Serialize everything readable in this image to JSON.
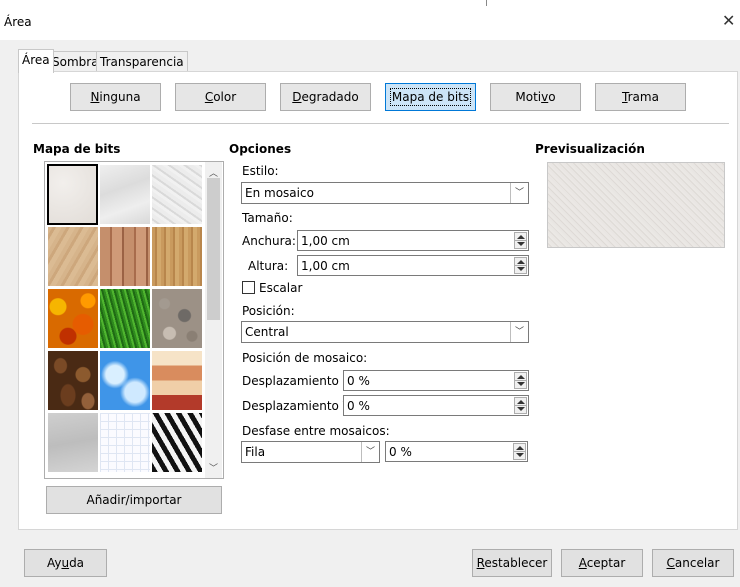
{
  "window": {
    "title": "Área",
    "close_glyph": "✕"
  },
  "tabs": [
    {
      "label": "Área",
      "active": true
    },
    {
      "label": "Sombra",
      "active": false
    },
    {
      "label": "Transparencia",
      "active": false
    }
  ],
  "fill_buttons": [
    {
      "label": "Ninguna",
      "mnemonic": "N",
      "selected": false
    },
    {
      "label": "Color",
      "mnemonic": "C",
      "selected": false
    },
    {
      "label": "Degradado",
      "mnemonic": "D",
      "selected": false
    },
    {
      "label": "Mapa de bits",
      "mnemonic": "",
      "selected": true
    },
    {
      "label": "Motivo",
      "mnemonic": "v",
      "selected": false
    },
    {
      "label": "Trama",
      "mnemonic": "T",
      "selected": false
    }
  ],
  "bitmap_section": {
    "heading": "Mapa de bits",
    "add_button": "Añadir/importar",
    "tiles": [
      "painted-white",
      "paper-texture",
      "paper-crumpled",
      "parchment",
      "fence",
      "wooden-board",
      "maple-leaves",
      "lawn",
      "pebbles",
      "coffee-beans",
      "clouds",
      "color-stripes",
      "concrete",
      "paper-graph",
      "zebra"
    ],
    "selected_tile_index": 0
  },
  "options": {
    "heading": "Opciones",
    "style_label": "Estilo:",
    "style_value": "En mosaico",
    "size_label": "Tamaño:",
    "width_label": "Anchura:",
    "width_value": "1,00 cm",
    "height_label": "Altura:",
    "height_value": "1,00 cm",
    "scale_label": "Escalar",
    "scale_checked": false,
    "position_label": "Posición:",
    "position_value": "Central",
    "tile_position_label": "Posición de mosaico:",
    "offset_x_label": "Desplazamiento X:",
    "offset_x_value": "0 %",
    "offset_y_label": "Desplazamiento Y:",
    "offset_y_value": "0 %",
    "tile_offset_label": "Desfase entre mosaicos:",
    "tile_offset_type": "Fila",
    "tile_offset_value": "0 %"
  },
  "preview": {
    "heading": "Previsualización"
  },
  "footer": {
    "help": "Ayuda",
    "reset": "Restablecer",
    "ok": "Aceptar",
    "cancel": "Cancelar"
  },
  "colors": {
    "accent": "#0078d7",
    "selected_button_bg": "#cce4f7",
    "dialog_bg": "#f0f0f0"
  }
}
